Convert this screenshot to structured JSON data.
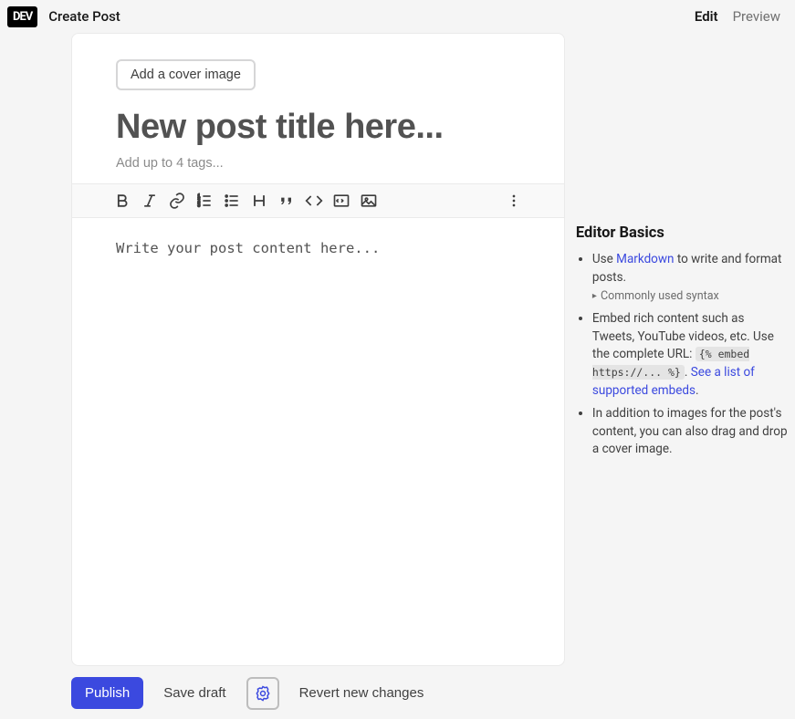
{
  "header": {
    "logo_text": "DEV",
    "title": "Create Post",
    "tabs": {
      "edit": "Edit",
      "preview": "Preview"
    }
  },
  "editor": {
    "cover_button": "Add a cover image",
    "title_placeholder": "New post title here...",
    "tags_placeholder": "Add up to 4 tags...",
    "content_placeholder": "Write your post content here..."
  },
  "toolbar": {
    "bold": "bold",
    "italic": "italic",
    "link": "link",
    "ol": "ordered-list",
    "ul": "unordered-list",
    "heading": "heading",
    "quote": "quote",
    "code": "code",
    "codeblock": "codeblock",
    "image": "image",
    "more": "more"
  },
  "sidebar": {
    "heading": "Editor Basics",
    "item1_prefix": "Use ",
    "item1_link": "Markdown",
    "item1_suffix": " to write and format posts.",
    "item1_details": "Commonly used syntax",
    "item2_text": "Embed rich content such as Tweets, YouTube videos, etc. Use the complete URL: ",
    "item2_code": "{% embed https://... %}",
    "item2_dot": ". ",
    "item2_link": "See a list of supported embeds",
    "item2_end": ".",
    "item3": "In addition to images for the post's content, you can also drag and drop a cover image."
  },
  "footer": {
    "publish": "Publish",
    "save_draft": "Save draft",
    "revert": "Revert new changes"
  }
}
